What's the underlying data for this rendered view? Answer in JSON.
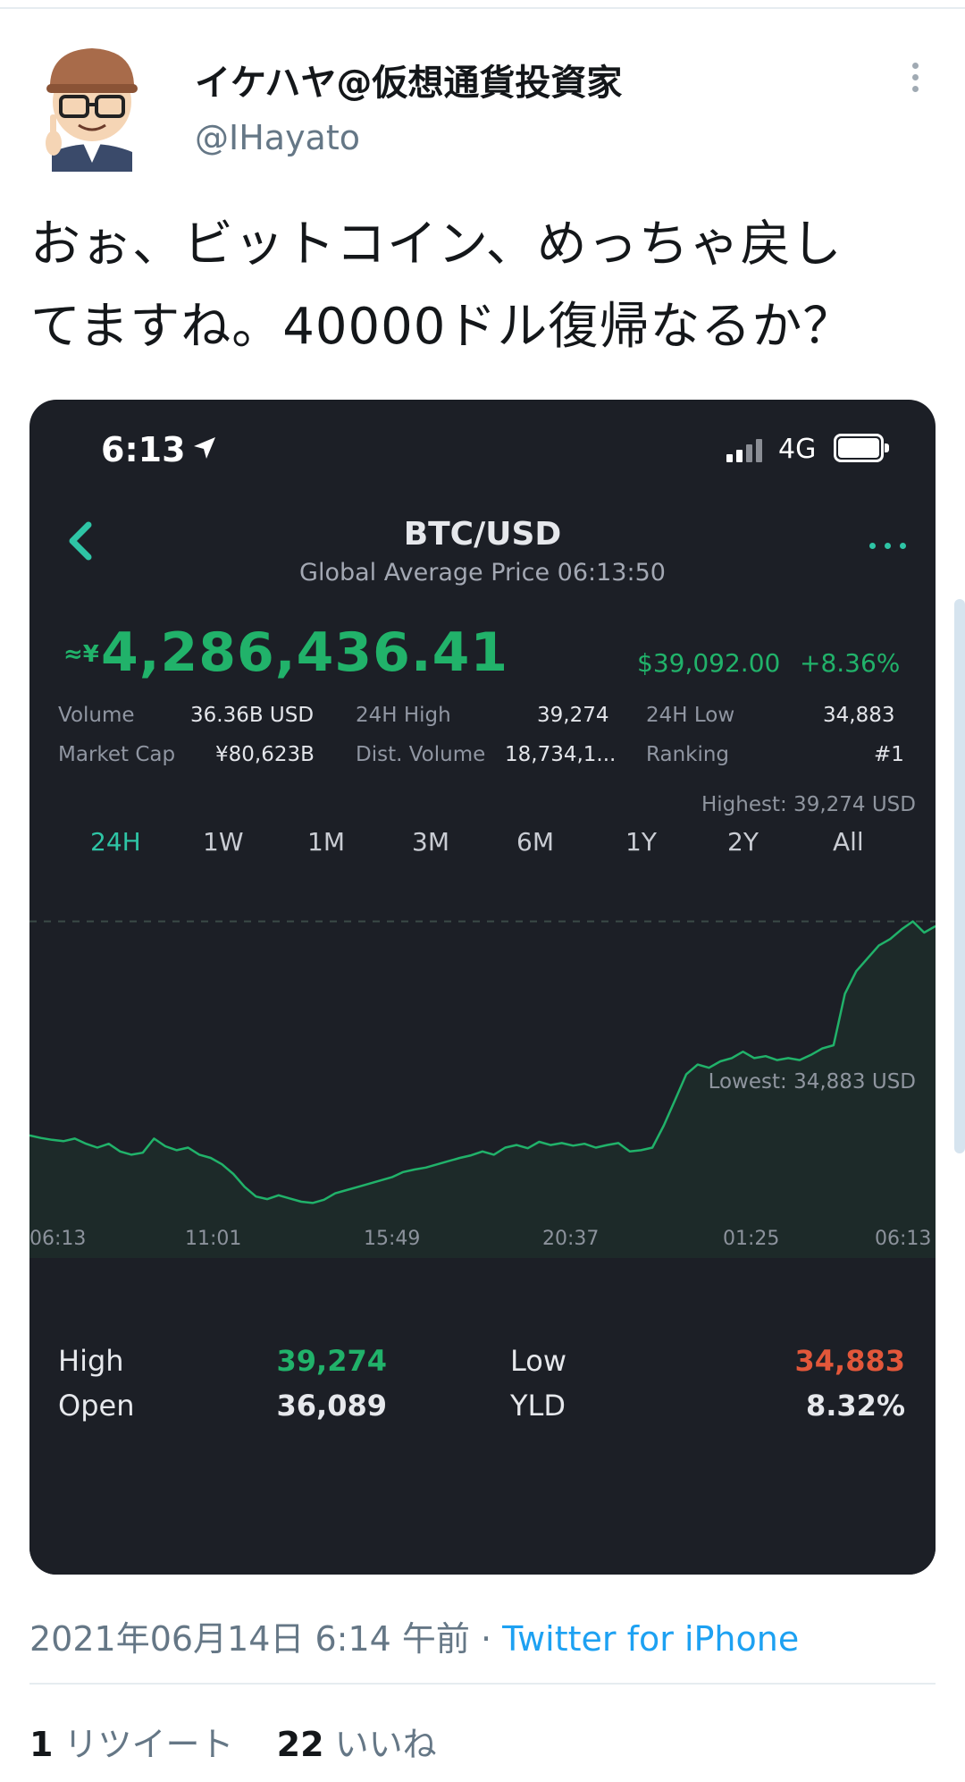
{
  "tweet": {
    "display_name": "イケハヤ@仮想通貨投資家",
    "handle": "@IHayato",
    "text_line1": "おぉ、ビットコイン、めっちゃ戻し",
    "text_line2": "てますね。40000ドル復帰なるか？",
    "timestamp": "2021年06月14日 6:14 午前 ·",
    "source": "Twitter for iPhone",
    "retweets_count": "1",
    "retweets_label": "リツイート",
    "likes_count": "22",
    "likes_label": "いいね"
  },
  "phone": {
    "status_time": "6:13",
    "network": "4G",
    "pair": "BTC/USD",
    "subtitle": "Global Average Price 06:13:50",
    "approx_symbol": "≈¥",
    "price_jpy": "4,286,436.41",
    "price_usd": "$39,092.00",
    "change_pct": "+8.36%",
    "stats": {
      "volume_label": "Volume",
      "volume_value": "36.36B USD",
      "high24_label": "24H High",
      "high24_value": "39,274",
      "low24_label": "24H Low",
      "low24_value": "34,883",
      "mcap_label": "Market Cap",
      "mcap_value": "¥80,623B",
      "distvol_label": "Dist. Volume",
      "distvol_value": "18,734,1...",
      "rank_label": "Ranking",
      "rank_value": "#1"
    },
    "tabs": [
      "24H",
      "1W",
      "1M",
      "3M",
      "6M",
      "1Y",
      "2Y",
      "All"
    ],
    "active_tab": "24H",
    "summary": {
      "high_label": "High",
      "high_value": "39,274",
      "low_label": "Low",
      "low_value": "34,883",
      "open_label": "Open",
      "open_value": "36,089",
      "yld_label": "YLD",
      "yld_value": "8.32%"
    },
    "colors": {
      "up": "#21b26a",
      "down": "#e2573a",
      "accent": "#2ec4a5",
      "card_bg": "#1c1f26"
    }
  },
  "chart_data": {
    "type": "area",
    "annotation_high": "Highest: 39,274 USD",
    "annotation_low": "Lowest: 34,883 USD",
    "x_ticks": [
      "06:13",
      "11:01",
      "15:49",
      "20:37",
      "01:25",
      "06:13"
    ],
    "x": [
      0.0,
      0.3,
      0.6,
      0.9,
      1.2,
      1.5,
      1.8,
      2.1,
      2.4,
      2.7,
      3.0,
      3.3,
      3.6,
      3.9,
      4.2,
      4.5,
      4.8,
      5.1,
      5.4,
      5.7,
      6.0,
      6.3,
      6.6,
      6.9,
      7.2,
      7.5,
      7.8,
      8.1,
      8.4,
      8.7,
      9.0,
      9.3,
      9.6,
      9.9,
      10.2,
      10.5,
      10.8,
      11.1,
      11.4,
      11.7,
      12.0,
      12.3,
      12.6,
      12.9,
      13.2,
      13.5,
      13.8,
      14.1,
      14.4,
      14.7,
      15.0,
      15.3,
      15.6,
      15.9,
      16.2,
      16.5,
      16.8,
      17.1,
      17.4,
      17.7,
      18.0,
      18.3,
      18.6,
      18.9,
      19.2,
      19.5,
      19.8,
      20.1,
      20.4,
      20.7,
      21.0,
      21.3,
      21.6,
      21.9,
      22.2,
      22.5,
      22.8,
      23.1,
      23.4,
      23.7,
      24.0
    ],
    "y": [
      35950,
      35910,
      35880,
      35860,
      35900,
      35820,
      35760,
      35820,
      35700,
      35650,
      35680,
      35900,
      35780,
      35720,
      35760,
      35650,
      35600,
      35500,
      35350,
      35150,
      35000,
      34960,
      35020,
      34970,
      34920,
      34900,
      34950,
      35050,
      35100,
      35150,
      35200,
      35250,
      35300,
      35380,
      35420,
      35450,
      35500,
      35550,
      35600,
      35640,
      35700,
      35650,
      35760,
      35800,
      35750,
      35850,
      35800,
      35830,
      35790,
      35820,
      35760,
      35800,
      35830,
      35700,
      35720,
      35760,
      36100,
      36500,
      36900,
      37050,
      37000,
      37100,
      37150,
      37250,
      37150,
      37180,
      37120,
      37150,
      37120,
      37200,
      37300,
      37350,
      38150,
      38500,
      38700,
      38900,
      39000,
      39150,
      39274,
      39100,
      39200
    ],
    "ylim": [
      34600,
      39600
    ],
    "highest": 39274,
    "lowest": 34883
  }
}
